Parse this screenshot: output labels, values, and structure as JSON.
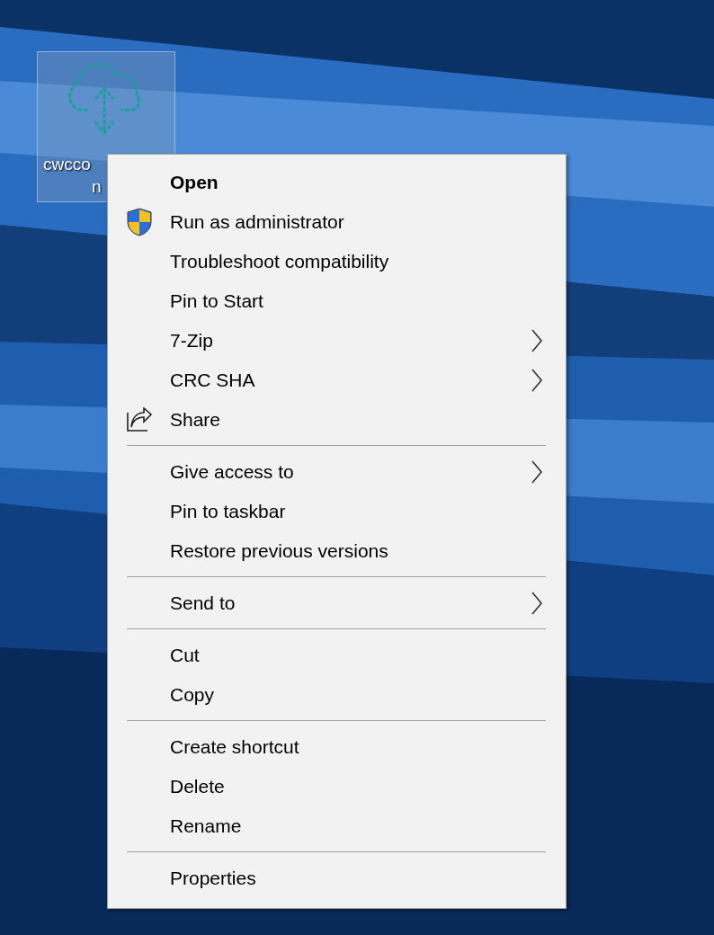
{
  "desktop_icon": {
    "label_lines": [
      "cwcco",
      "n"
    ],
    "selected": true
  },
  "context_menu": {
    "groups": [
      [
        {
          "label": "Open",
          "kind": "text",
          "default": true,
          "submenu": false
        },
        {
          "label": "Run as administrator",
          "kind": "shield",
          "default": false,
          "submenu": false
        },
        {
          "label": "Troubleshoot compatibility",
          "kind": "text",
          "default": false,
          "submenu": false
        },
        {
          "label": "Pin to Start",
          "kind": "text",
          "default": false,
          "submenu": false
        },
        {
          "label": "7-Zip",
          "kind": "text",
          "default": false,
          "submenu": true
        },
        {
          "label": "CRC SHA",
          "kind": "text",
          "default": false,
          "submenu": true
        },
        {
          "label": "Share",
          "kind": "share",
          "default": false,
          "submenu": false
        }
      ],
      [
        {
          "label": "Give access to",
          "kind": "text",
          "default": false,
          "submenu": true
        },
        {
          "label": "Pin to taskbar",
          "kind": "text",
          "default": false,
          "submenu": false
        },
        {
          "label": "Restore previous versions",
          "kind": "text",
          "default": false,
          "submenu": false
        }
      ],
      [
        {
          "label": "Send to",
          "kind": "text",
          "default": false,
          "submenu": true
        }
      ],
      [
        {
          "label": "Cut",
          "kind": "text",
          "default": false,
          "submenu": false
        },
        {
          "label": "Copy",
          "kind": "text",
          "default": false,
          "submenu": false
        }
      ],
      [
        {
          "label": "Create shortcut",
          "kind": "text",
          "default": false,
          "submenu": false
        },
        {
          "label": "Delete",
          "kind": "text",
          "default": false,
          "submenu": false
        },
        {
          "label": "Rename",
          "kind": "text",
          "default": false,
          "submenu": false
        }
      ],
      [
        {
          "label": "Properties",
          "kind": "text",
          "default": false,
          "submenu": false
        }
      ]
    ]
  }
}
